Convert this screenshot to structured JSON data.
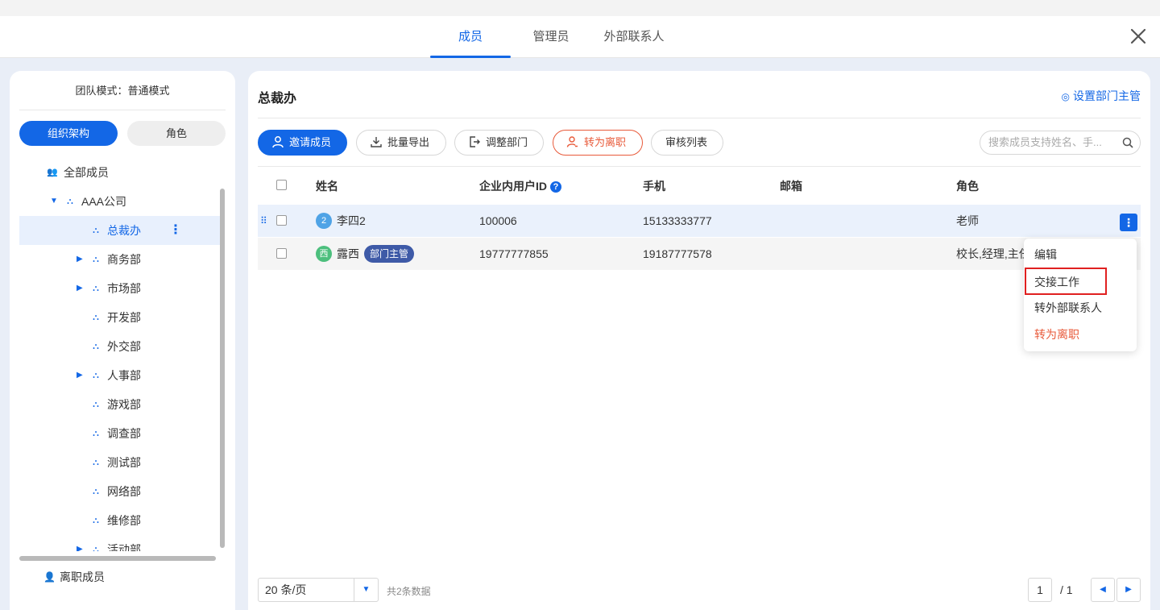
{
  "tabs": [
    {
      "label": "成员",
      "active": true
    },
    {
      "label": "管理员",
      "active": false
    },
    {
      "label": "外部联系人",
      "active": false
    }
  ],
  "left": {
    "mode_title": "团队模式：普通模式",
    "seg_org": "组织架构",
    "seg_role": "角色",
    "tree": [
      {
        "label": "全部成员",
        "icon": "members-icon"
      },
      {
        "label": "AAA公司",
        "expanded": true
      },
      {
        "label": "总裁办",
        "selected": true
      },
      {
        "label": "商务部",
        "has_children": true
      },
      {
        "label": "市场部",
        "has_children": true
      },
      {
        "label": "开发部"
      },
      {
        "label": "外交部"
      },
      {
        "label": "人事部",
        "has_children": true
      },
      {
        "label": "游戏部"
      },
      {
        "label": "调查部"
      },
      {
        "label": "测试部"
      },
      {
        "label": "网络部"
      },
      {
        "label": "维修部"
      },
      {
        "label": "活动部",
        "has_children": true
      }
    ],
    "resigned": "离职成员"
  },
  "main": {
    "dept_title": "总裁办",
    "set_head": "设置部门主管",
    "toolbar": {
      "invite": "邀请成员",
      "export": "批量导出",
      "adjust": "调整部门",
      "leave": "转为离职",
      "review": "审核列表"
    },
    "search_placeholder": "搜索成员支持姓名、手...",
    "columns": {
      "name": "姓名",
      "uid": "企业内用户ID",
      "phone": "手机",
      "email": "邮箱",
      "role": "角色"
    },
    "rows": [
      {
        "avatar": "2",
        "name": "李四2",
        "uid": "100006",
        "phone": "15133333777",
        "email": "",
        "role": "老师"
      },
      {
        "avatar": "西",
        "name": "露西",
        "badge": "部门主管",
        "uid": "19777777855",
        "phone": "19187777578",
        "email": "",
        "role": "校长,经理,主任"
      }
    ],
    "menu": [
      "编辑",
      "交接工作",
      "转外部联系人",
      "转为离职"
    ],
    "pagination": {
      "page_size": "20 条/页",
      "total": "共2条数据",
      "current": "1",
      "of": "/ 1"
    }
  },
  "colors": {
    "accent": "#1367e6",
    "danger": "#e85a3a",
    "badge": "#3e5aa7"
  }
}
